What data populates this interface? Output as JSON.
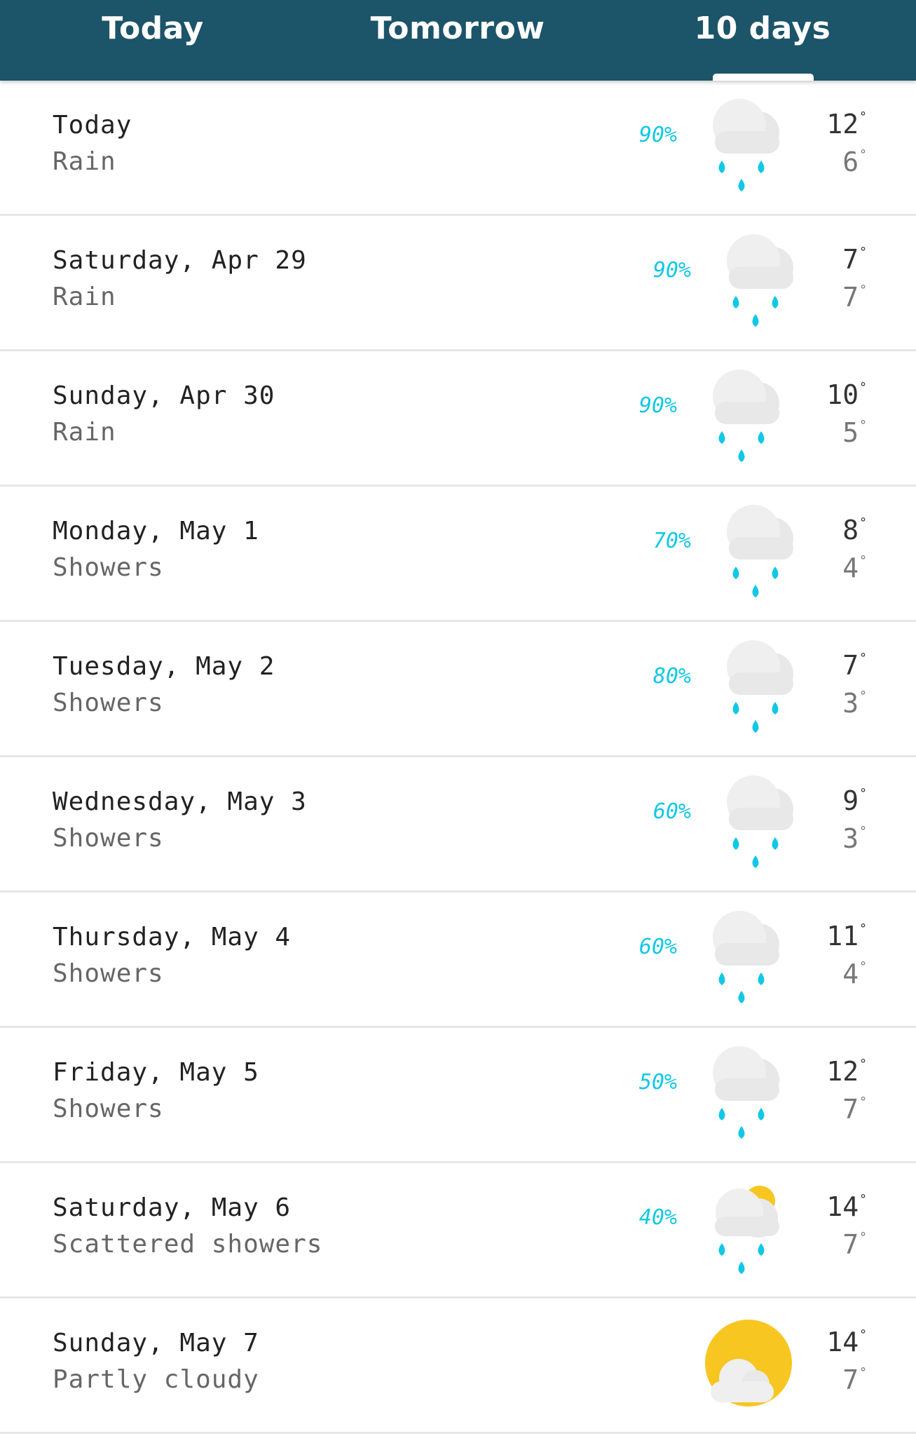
{
  "tabs": [
    {
      "label": "Today"
    },
    {
      "label": "Tomorrow"
    },
    {
      "label": "10 days"
    }
  ],
  "active_tab": "10 days",
  "colors": {
    "header": "#1c5469",
    "precip": "#10c8e6",
    "sun": "#f7c620",
    "cloud": "#e8e8e8"
  },
  "forecast": [
    {
      "day": "Today",
      "condition": "Rain",
      "precip": "90%",
      "high": "12",
      "low": "6",
      "icon": "rain-icon"
    },
    {
      "day": "Saturday, Apr 29",
      "condition": "Rain",
      "precip": "90%",
      "high": "7",
      "low": "7",
      "icon": "rain-icon"
    },
    {
      "day": "Sunday, Apr 30",
      "condition": "Rain",
      "precip": "90%",
      "high": "10",
      "low": "5",
      "icon": "rain-icon"
    },
    {
      "day": "Monday, May 1",
      "condition": "Showers",
      "precip": "70%",
      "high": "8",
      "low": "4",
      "icon": "rain-icon"
    },
    {
      "day": "Tuesday, May 2",
      "condition": "Showers",
      "precip": "80%",
      "high": "7",
      "low": "3",
      "icon": "rain-icon"
    },
    {
      "day": "Wednesday, May 3",
      "condition": "Showers",
      "precip": "60%",
      "high": "9",
      "low": "3",
      "icon": "rain-icon"
    },
    {
      "day": "Thursday, May 4",
      "condition": "Showers",
      "precip": "60%",
      "high": "11",
      "low": "4",
      "icon": "rain-icon"
    },
    {
      "day": "Friday, May 5",
      "condition": "Showers",
      "precip": "50%",
      "high": "12",
      "low": "7",
      "icon": "rain-icon"
    },
    {
      "day": "Saturday, May 6",
      "condition": "Scattered showers",
      "precip": "40%",
      "high": "14",
      "low": "7",
      "icon": "sun-rain-icon"
    },
    {
      "day": "Sunday, May 7",
      "condition": "Partly cloudy",
      "precip": "",
      "high": "14",
      "low": "7",
      "icon": "partly-cloudy-icon"
    }
  ]
}
